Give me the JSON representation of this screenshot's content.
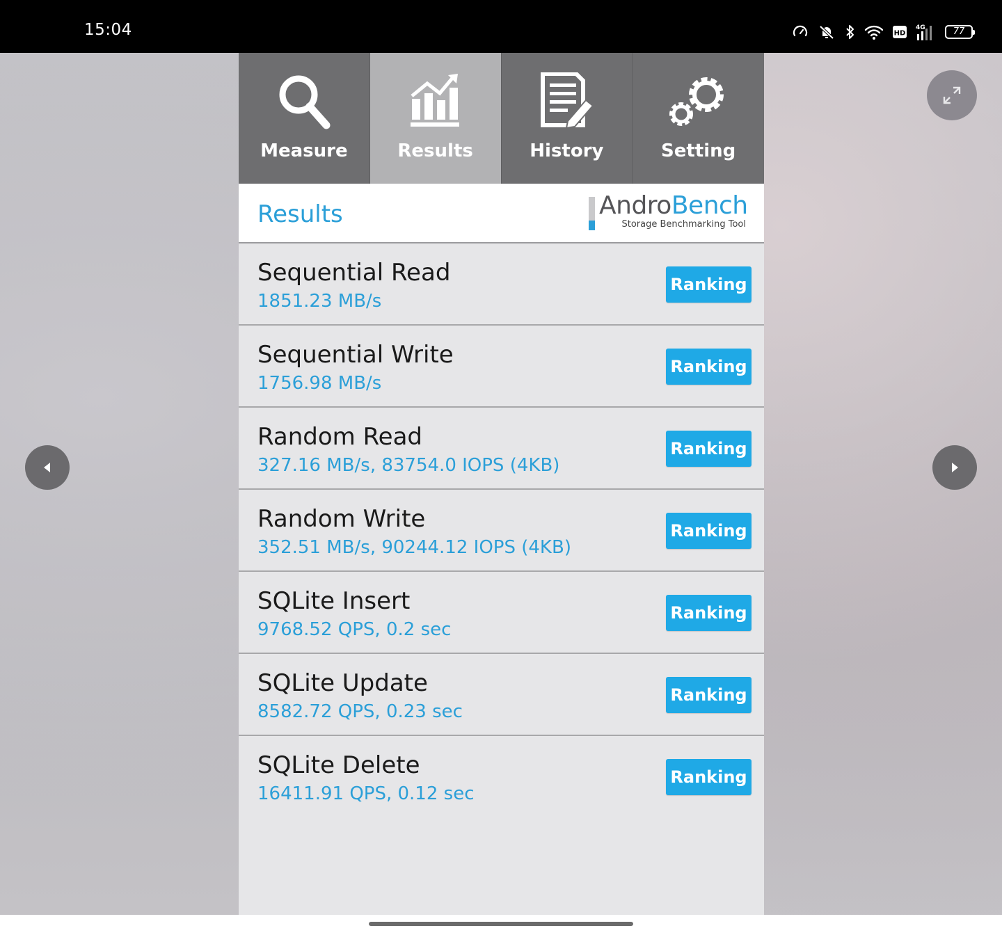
{
  "status_bar": {
    "time": "15:04",
    "battery": "77",
    "icons": [
      "speedometer-icon",
      "mute-icon",
      "bluetooth-icon",
      "wifi-icon",
      "hd-icon",
      "signal-4g-icon",
      "battery-icon"
    ]
  },
  "tabs": [
    {
      "label": "Measure",
      "icon": "magnifier-icon",
      "active": false
    },
    {
      "label": "Results",
      "icon": "chart-icon",
      "active": true
    },
    {
      "label": "History",
      "icon": "document-icon",
      "active": false
    },
    {
      "label": "Setting",
      "icon": "gear-icon",
      "active": false
    }
  ],
  "header": {
    "title": "Results",
    "logo_part1": "Andro",
    "logo_part2": "Bench",
    "tagline": "Storage Benchmarking Tool"
  },
  "results": [
    {
      "name": "Sequential Read",
      "value": "1851.23 MB/s",
      "button": "Ranking"
    },
    {
      "name": "Sequential Write",
      "value": "1756.98 MB/s",
      "button": "Ranking"
    },
    {
      "name": "Random Read",
      "value": "327.16 MB/s, 83754.0 IOPS (4KB)",
      "button": "Ranking"
    },
    {
      "name": "Random Write",
      "value": "352.51 MB/s, 90244.12 IOPS (4KB)",
      "button": "Ranking"
    },
    {
      "name": "SQLite Insert",
      "value": "9768.52 QPS, 0.2 sec",
      "button": "Ranking"
    },
    {
      "name": "SQLite Update",
      "value": "8582.72 QPS, 0.23 sec",
      "button": "Ranking"
    },
    {
      "name": "SQLite Delete",
      "value": "16411.91 QPS, 0.12 sec",
      "button": "Ranking"
    }
  ],
  "colors": {
    "accent": "#2b9fd8",
    "button": "#1fa9e6",
    "tab_bg": "#6e6e70",
    "tab_active_bg": "#b2b2b4"
  }
}
